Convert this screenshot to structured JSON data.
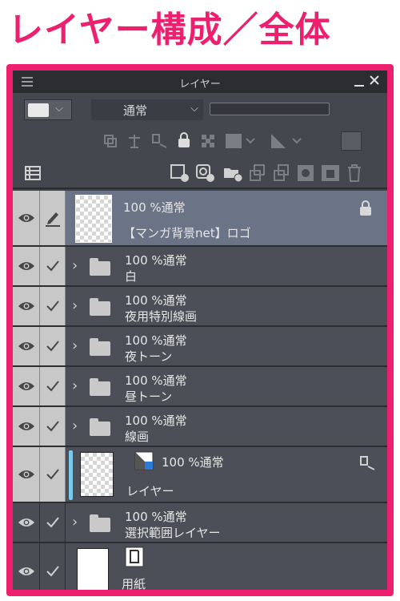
{
  "heading": "レイヤー構成／全体",
  "panel": {
    "title": "レイヤー",
    "blend_mode": "通常",
    "accent": "#ee1f6e",
    "selected_row_color": "#6b7487",
    "icons": {
      "menu": "menu-icon",
      "minimize": "minimize-icon",
      "close": "close-icon",
      "eye": "eye-icon",
      "check": "check-icon",
      "pen": "pen-icon",
      "lock": "lock-icon",
      "folder": "folder-icon",
      "expand": "chevron-right-icon"
    }
  },
  "layers": [
    {
      "opacity": "100 %通常",
      "name": "【マンガ背景net】ロゴ",
      "type": "raster",
      "selected": true,
      "locked": true
    },
    {
      "opacity": "100 %通常",
      "name": "白",
      "type": "folder"
    },
    {
      "opacity": "100 %通常",
      "name": "夜用特別線画",
      "type": "folder"
    },
    {
      "opacity": "100 %通常",
      "name": "夜トーン",
      "type": "folder"
    },
    {
      "opacity": "100 %通常",
      "name": "昼トーン",
      "type": "folder"
    },
    {
      "opacity": "100 %通常",
      "name": "線画",
      "type": "folder"
    },
    {
      "opacity": "100 %通常",
      "name": "レイヤー",
      "type": "raster"
    },
    {
      "opacity": "100 %通常",
      "name": "選択範囲レイヤー",
      "type": "folder"
    },
    {
      "opacity": "",
      "name": "用紙",
      "type": "paper"
    }
  ]
}
